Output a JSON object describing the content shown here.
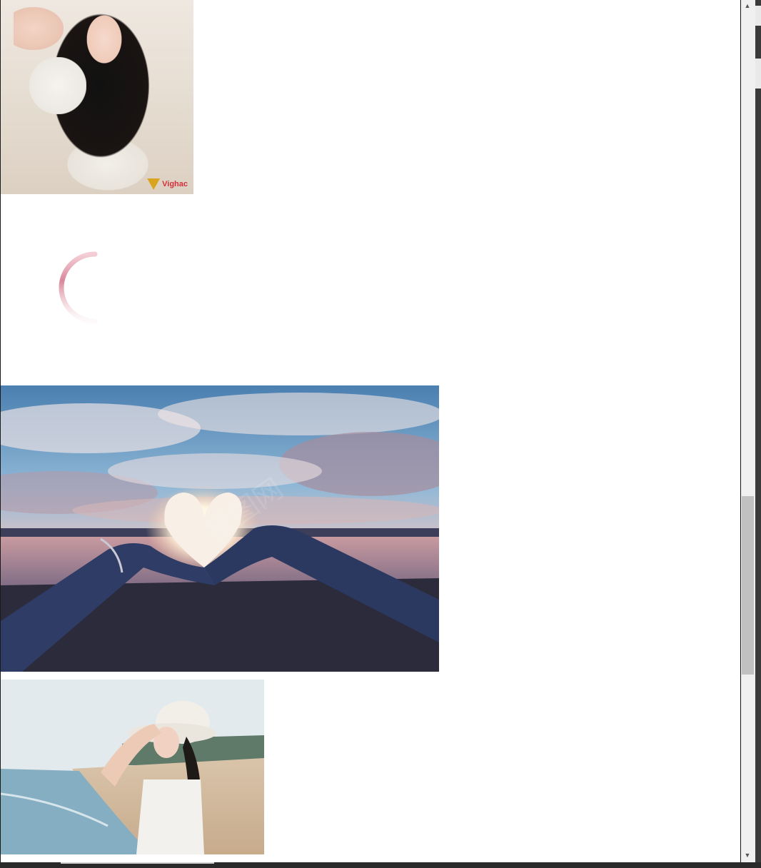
{
  "page": {
    "images": [
      {
        "name": "portrait-selfie-image",
        "watermark": "Vighac"
      },
      {
        "name": "heart-hands-sunset-image"
      },
      {
        "name": "beach-hat-woman-image"
      }
    ],
    "loading": {
      "icon": "loading-spinner-icon",
      "color": "#d9889a"
    }
  },
  "scrollbar": {
    "up_icon": "▲",
    "down_icon": "▼"
  }
}
